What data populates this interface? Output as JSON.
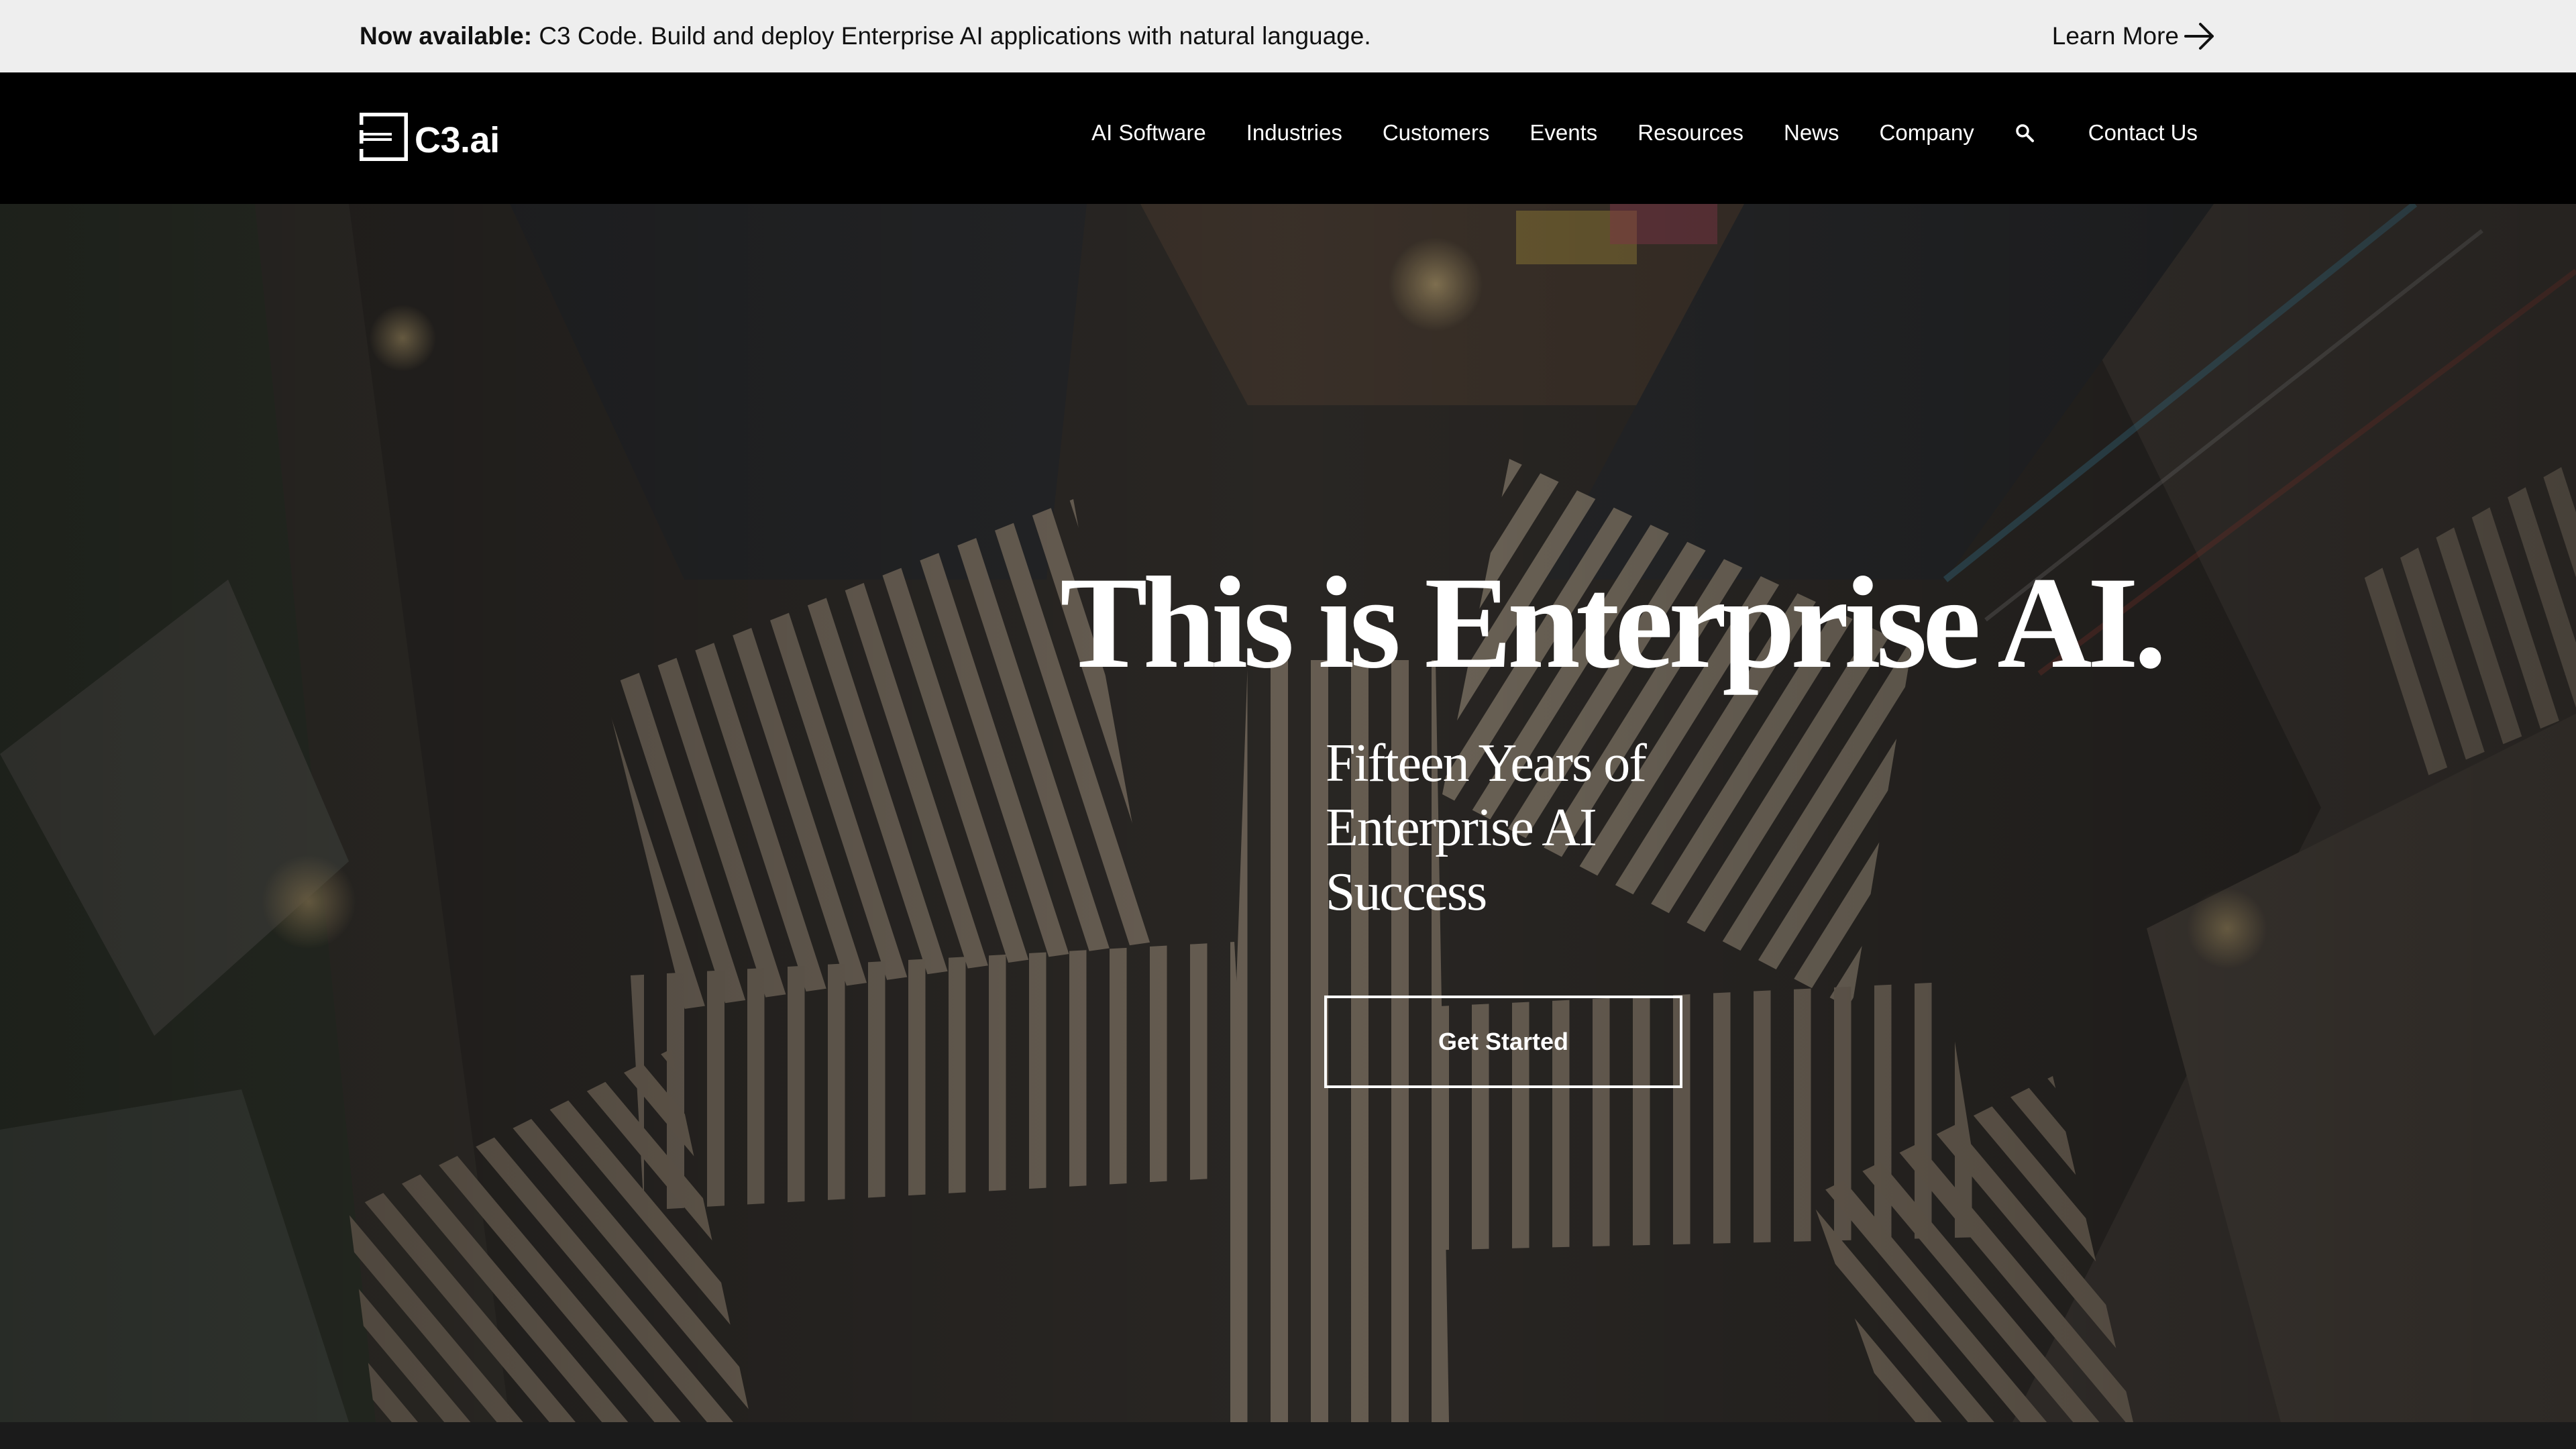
{
  "announcement": {
    "label": "Now available:",
    "text": "C3 Code. Build and deploy Enterprise AI applications with natural language.",
    "link": "Learn More"
  },
  "brand": {
    "name": "C3.ai",
    "icon": "c3-logo-icon"
  },
  "nav": {
    "items": [
      {
        "label": "AI Software"
      },
      {
        "label": "Industries"
      },
      {
        "label": "Customers"
      },
      {
        "label": "Events"
      },
      {
        "label": "Resources"
      },
      {
        "label": "News"
      },
      {
        "label": "Company"
      }
    ],
    "search_icon": "search-icon",
    "contact": "Contact Us"
  },
  "hero": {
    "title": "This is Enterprise AI.",
    "subtitle": "Fifteen Years of Enterprise AI Success",
    "cta": "Get Started",
    "background": "aerial-city-crosswalk-night-photo"
  },
  "colors": {
    "announcement_bg": "#eeeeee",
    "nav_bg": "#000000",
    "hero_overlay": "#2a2724",
    "text_light": "#ffffff",
    "text_dark": "#111111"
  }
}
